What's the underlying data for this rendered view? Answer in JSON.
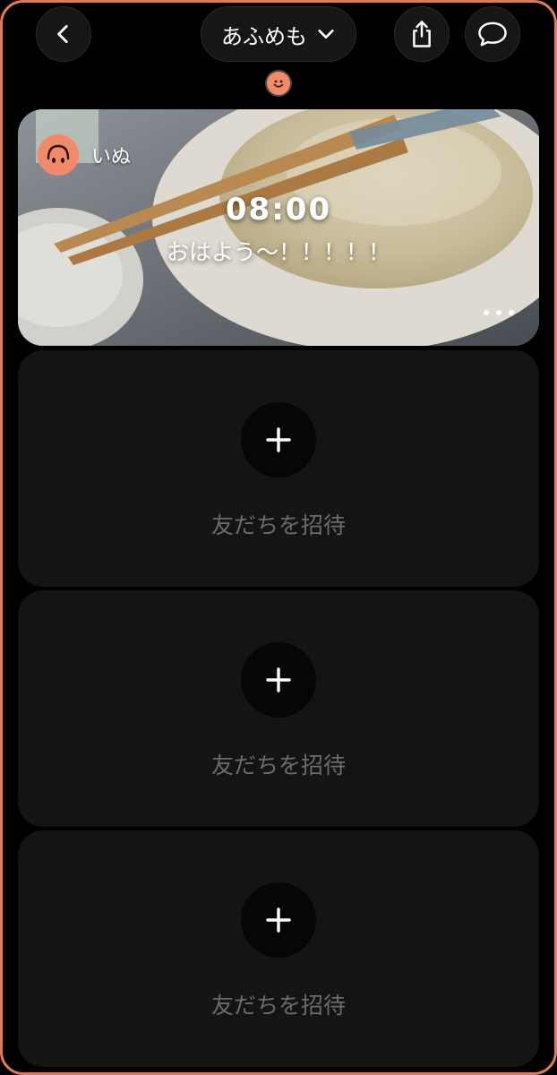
{
  "header": {
    "group_name": "あふめも",
    "back_icon": "chevron-left-icon",
    "dropdown_icon": "chevron-down-icon",
    "share_icon": "share-icon",
    "chat_icon": "chat-bubble-icon"
  },
  "post": {
    "author": "いぬ",
    "time": "08:00",
    "caption": "おはよう〜！！！！！"
  },
  "invite_slots": [
    {
      "label": "友だちを招待"
    },
    {
      "label": "友だちを招待"
    },
    {
      "label": "友だちを招待"
    }
  ],
  "colors": {
    "accent": "#f08a6b",
    "frame": "#e07a5a",
    "card_bg": "#141414"
  }
}
